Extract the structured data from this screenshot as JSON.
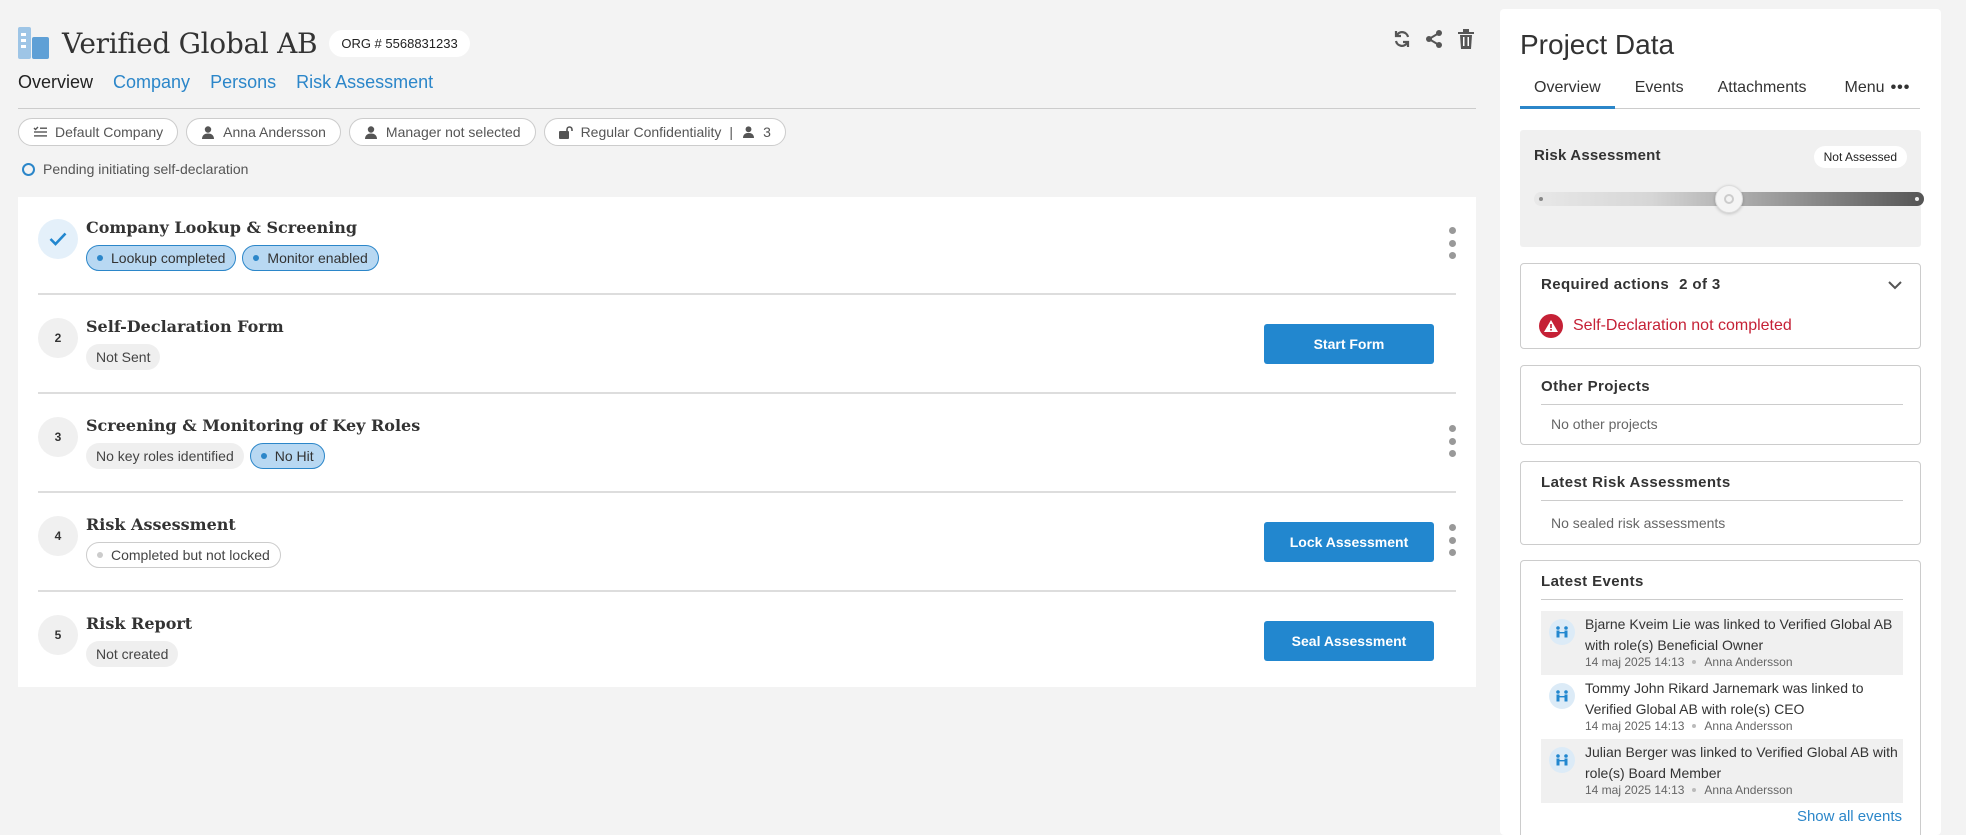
{
  "header": {
    "company_name": "Verified Global AB",
    "org_number": "ORG # 5568831233",
    "icons": [
      "refresh-icon",
      "share-icon",
      "trash-icon"
    ]
  },
  "tabs": [
    {
      "label": "Overview",
      "active": true
    },
    {
      "label": "Company",
      "active": false
    },
    {
      "label": "Persons",
      "active": false
    },
    {
      "label": "Risk Assessment",
      "active": false
    }
  ],
  "chips": {
    "profile": "Default Company",
    "user": "Anna Andersson",
    "manager": "Manager not selected",
    "confidentiality": "Regular Confidentiality",
    "members_count": "3"
  },
  "pending_status": "Pending initiating self-declaration",
  "steps": [
    {
      "number": "",
      "done": true,
      "title": "Company Lookup & Screening",
      "tags": [
        "Lookup completed",
        "Monitor enabled"
      ]
    },
    {
      "number": "2",
      "title": "Self-Declaration Form",
      "tags": [
        "Not Sent"
      ],
      "button": "Start Form"
    },
    {
      "number": "3",
      "title": "Screening & Monitoring of Key Roles",
      "tags": [
        "No key roles identified",
        "No Hit"
      ]
    },
    {
      "number": "4",
      "title": "Risk Assessment",
      "tags": [
        "Completed but not locked"
      ],
      "button": "Lock Assessment"
    },
    {
      "number": "5",
      "title": "Risk Report",
      "tags": [
        "Not created"
      ],
      "button": "Seal Assessment"
    }
  ],
  "panel": {
    "title": "Project Data",
    "tabs": [
      "Overview",
      "Events",
      "Attachments",
      "Menu"
    ],
    "risk": {
      "label": "Risk Assessment",
      "status": "Not Assessed",
      "level": 0.5
    },
    "required": {
      "label": "Required actions",
      "count": "2 of 3",
      "item": "Self-Declaration not completed"
    },
    "other_projects": {
      "label": "Other Projects",
      "empty": "No other projects"
    },
    "latest_risk": {
      "label": "Latest Risk Assessments",
      "empty": "No sealed risk assessments"
    },
    "latest_events": {
      "label": "Latest Events",
      "items": [
        {
          "text": "Bjarne Kveim Lie was linked to Verified Global AB with role(s) Beneficial Owner",
          "date": "14 maj 2025 14:13",
          "user": "Anna Andersson"
        },
        {
          "text": "Tommy John Rikard Jarnemark was linked to Verified Global AB with role(s) CEO",
          "date": "14 maj 2025 14:13",
          "user": "Anna Andersson"
        },
        {
          "text": "Julian Berger was linked to Verified Global AB with role(s) Board Member",
          "date": "14 maj 2025 14:13",
          "user": "Anna Andersson"
        }
      ],
      "show_all": "Show all events"
    }
  },
  "colors": {
    "accent": "#2287cf",
    "link": "#2b86c9",
    "danger": "#c52136",
    "tag_blue": "#b8d8f2"
  }
}
